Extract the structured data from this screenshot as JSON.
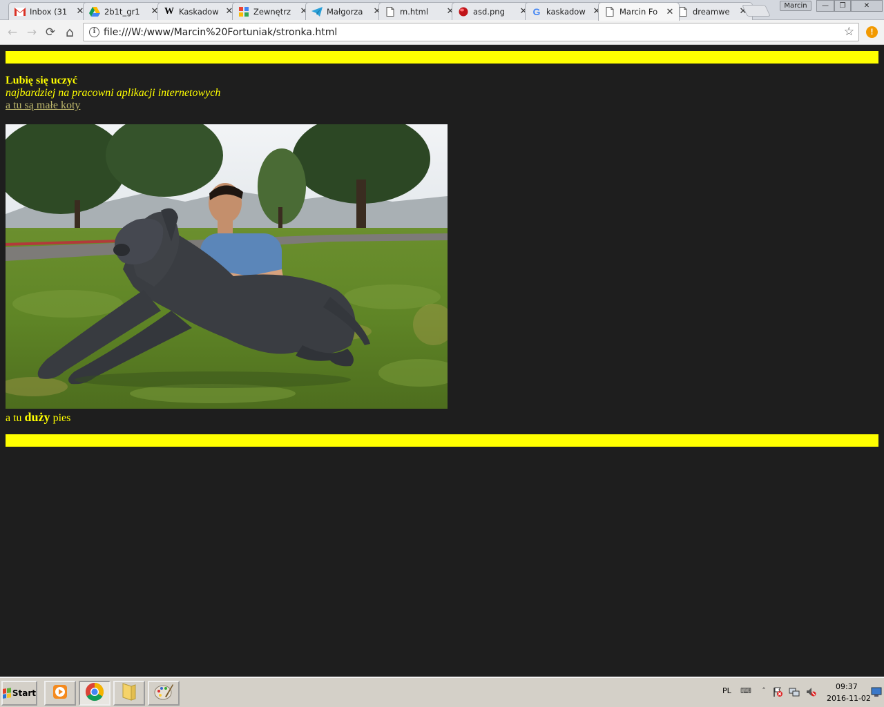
{
  "browser": {
    "profile_name": "Marcin",
    "window_buttons": {
      "minimize": "—",
      "restore": "❐",
      "close": "✕"
    },
    "tabs": [
      {
        "title": "Inbox (31",
        "icon": "gmail-icon"
      },
      {
        "title": "2b1t_gr1",
        "icon": "google-drive-icon"
      },
      {
        "title": "Kaskadow",
        "icon": "wikipedia-icon"
      },
      {
        "title": "Zewnętrz",
        "icon": "google-apps-icon"
      },
      {
        "title": "Małgorza",
        "icon": "telegram-icon"
      },
      {
        "title": "m.html",
        "icon": "file-icon"
      },
      {
        "title": "asd.png",
        "icon": "red-ball-icon"
      },
      {
        "title": "kaskadow",
        "icon": "google-icon"
      },
      {
        "title": "Marcin Fo",
        "icon": "file-icon",
        "active": true
      },
      {
        "title": "dreamwe",
        "icon": "file-icon"
      }
    ],
    "url": "file:///W:/www/Marcin%20Fortuniak/stronka.html",
    "nav": {
      "back": "←",
      "forward": "→",
      "reload": "⟳",
      "home": "⌂"
    }
  },
  "page": {
    "heading": "Lubię się uczyć",
    "subtitle": "najbardziej na pracowni aplikacji internetowych",
    "link_text": "a tu są małe koty",
    "caption_prefix": "a tu ",
    "caption_bold": "duży",
    "caption_suffix": " pies",
    "colors": {
      "background": "#1e1e1e",
      "text": "#ffff00",
      "bar": "#ffff00",
      "link": "#bdb76b"
    }
  },
  "taskbar": {
    "start_label": "Start",
    "language": "PL",
    "time": "09:37",
    "date": "2016-11-02",
    "apps": [
      "media-player-icon",
      "chrome-icon",
      "folder-icon",
      "paint-icon"
    ]
  }
}
